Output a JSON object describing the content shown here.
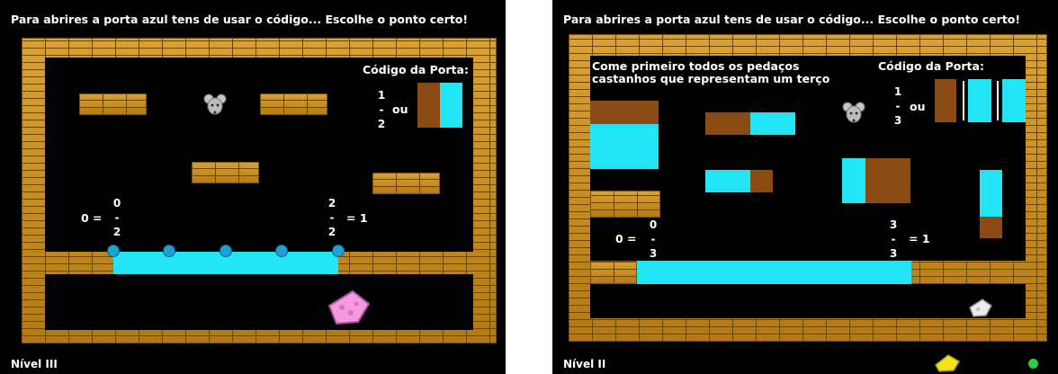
{
  "left_game": {
    "title": "Para abrires a porta azul tens de usar o código... Escolhe o ponto certo!",
    "level": "Nível III",
    "door_code_label": "Código da Porta:",
    "door_fraction": {
      "num": "1",
      "bar": "-",
      "den": "2"
    },
    "or_text": "ou",
    "left_fraction": {
      "prefix": "0 =",
      "num": "0",
      "bar": "-",
      "den": "2"
    },
    "right_fraction": {
      "num": "2",
      "bar": "-",
      "den": "2",
      "suffix": "= 1"
    },
    "door_colors": {
      "brown": "#8a4a12",
      "cyan": "#22e4f4"
    }
  },
  "right_game": {
    "title": "Para abrires a porta azul tens de usar o código... Escolhe o ponto certo!",
    "level": "Nível II",
    "instruction_line1": "Come primeiro todos os pedaços",
    "instruction_line2": "castanhos que representam um terço",
    "door_code_label": "Código da Porta:",
    "door_fraction": {
      "num": "1",
      "bar": "-",
      "den": "3"
    },
    "or_text": "ou",
    "left_fraction": {
      "prefix": "0 =",
      "num": "0",
      "bar": "-",
      "den": "3"
    },
    "right_fraction": {
      "num": "3",
      "bar": "-",
      "den": "3",
      "suffix": "= 1"
    }
  }
}
